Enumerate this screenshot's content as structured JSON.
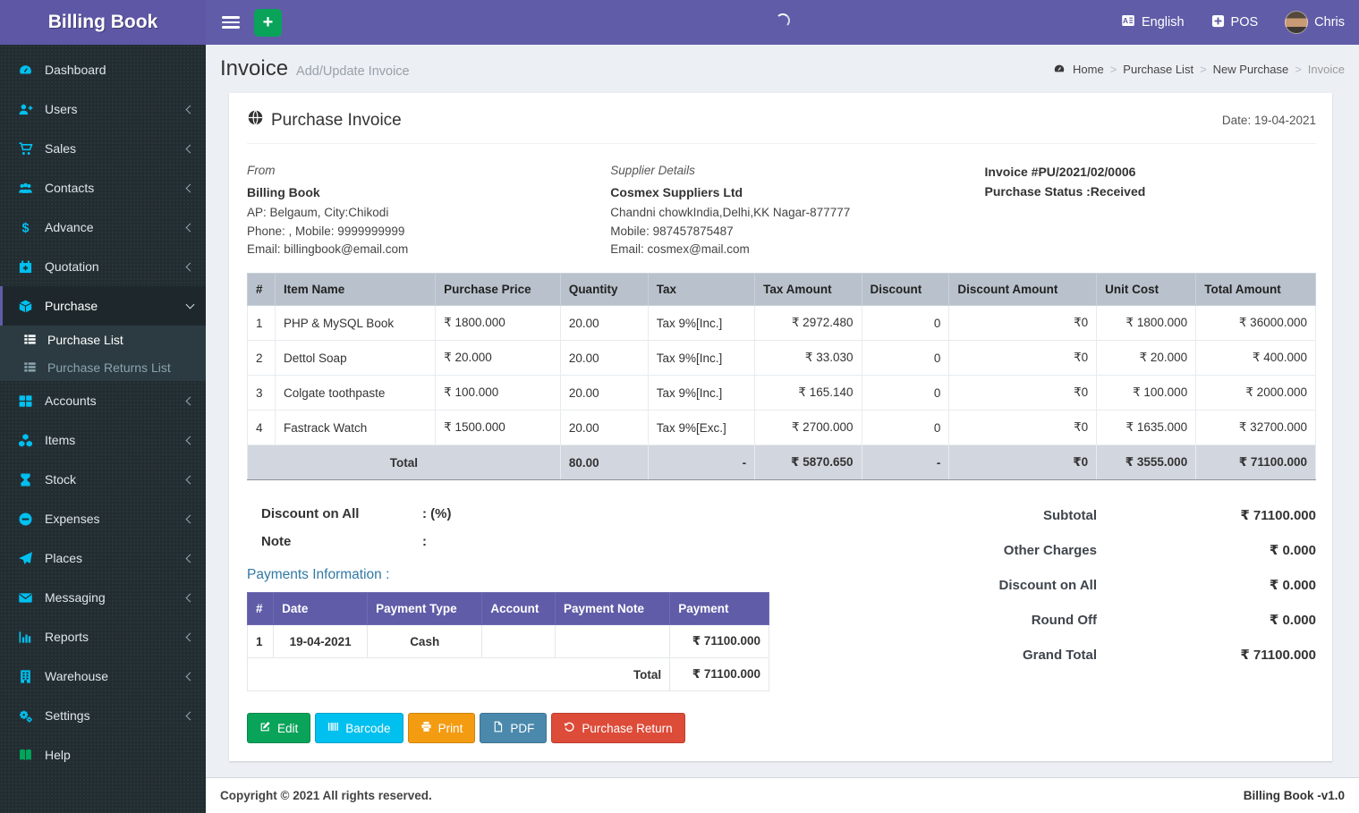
{
  "theme": {
    "topbar_purple": "#605ca8",
    "logo_purple": "#5d57a5",
    "sidebar_bg": "#222d32",
    "sidebar_icon_cyan": "#00c0ef",
    "content_bg": "#ecf0f5",
    "items_header_bg": "#b9c2cc",
    "total_row_bg": "#d2d6de",
    "payments_header_bg": "#605ca8",
    "btn_green": "#09a35a",
    "btn_cyan": "#00c0ef",
    "btn_orange": "#f39c12",
    "btn_blue": "#4a89ac",
    "btn_red": "#dd4b39"
  },
  "icons": {
    "menu-icon": "hamburger bars",
    "add-icon": "+",
    "language-icon": "translate page",
    "pos-icon": "plus-square",
    "home-icon": "gauge",
    "globe-icon": "globe",
    "chevron-left-icon": "‹",
    "chevron-down-icon": "⌄"
  },
  "topbar": {
    "brand": "Billing Book",
    "language": "English",
    "pos": "POS",
    "user": "Chris"
  },
  "sidebar": {
    "items": [
      {
        "label": "Dashboard",
        "icon": "dashboard-icon"
      },
      {
        "label": "Users",
        "icon": "user-plus-icon"
      },
      {
        "label": "Sales",
        "icon": "cart-icon"
      },
      {
        "label": "Contacts",
        "icon": "users-icon"
      },
      {
        "label": "Advance",
        "icon": "dollar-icon"
      },
      {
        "label": "Quotation",
        "icon": "calendar-plus-icon"
      },
      {
        "label": "Purchase",
        "icon": "cube-icon",
        "active": true,
        "expanded": true
      },
      {
        "label": "Accounts",
        "icon": "grid-icon"
      },
      {
        "label": "Items",
        "icon": "cubes-icon"
      },
      {
        "label": "Stock",
        "icon": "hourglass-icon"
      },
      {
        "label": "Expenses",
        "icon": "minus-circle-icon"
      },
      {
        "label": "Places",
        "icon": "paper-plane-icon"
      },
      {
        "label": "Messaging",
        "icon": "envelope-icon"
      },
      {
        "label": "Reports",
        "icon": "bar-chart-icon"
      },
      {
        "label": "Warehouse",
        "icon": "building-icon"
      },
      {
        "label": "Settings",
        "icon": "gears-icon"
      },
      {
        "label": "Help",
        "icon": "book-icon"
      }
    ],
    "submenu": [
      {
        "label": "Purchase List",
        "active": true
      },
      {
        "label": "Purchase Returns List",
        "active": false
      }
    ]
  },
  "page": {
    "title": "Invoice",
    "subtitle": "Add/Update Invoice",
    "breadcrumb": [
      "Home",
      "Purchase List",
      "New Purchase",
      "Invoice"
    ]
  },
  "invoice": {
    "card_title": "Purchase Invoice",
    "date": "Date: 19-04-2021",
    "from": {
      "heading": "From",
      "name": "Billing Book",
      "line1": "AP: Belgaum, City:Chikodi",
      "line2": "Phone: , Mobile: 9999999999",
      "line3": "Email: billingbook@email.com"
    },
    "supplier": {
      "heading": "Supplier Details",
      "name": "Cosmex Suppliers Ltd",
      "line1": "Chandni chowkIndia,Delhi,KK Nagar-877777",
      "line2": "Mobile: 987457875487",
      "line3": "Email: cosmex@mail.com"
    },
    "meta": {
      "invoice_no": "Invoice #PU/2021/02/0006",
      "status": "Purchase Status :Received"
    },
    "items_table": {
      "headers": [
        "#",
        "Item Name",
        "Purchase Price",
        "Quantity",
        "Tax",
        "Tax Amount",
        "Discount",
        "Discount Amount",
        "Unit Cost",
        "Total Amount"
      ],
      "rows": [
        [
          "1",
          "PHP & MySQL Book",
          "₹ 1800.000",
          "20.00",
          "Tax 9%[Inc.]",
          "₹ 2972.480",
          "0",
          "₹0",
          "₹ 1800.000",
          "₹ 36000.000"
        ],
        [
          "2",
          "Dettol Soap",
          "₹ 20.000",
          "20.00",
          "Tax 9%[Inc.]",
          "₹ 33.030",
          "0",
          "₹0",
          "₹ 20.000",
          "₹ 400.000"
        ],
        [
          "3",
          "Colgate toothpaste",
          "₹ 100.000",
          "20.00",
          "Tax 9%[Inc.]",
          "₹ 165.140",
          "0",
          "₹0",
          "₹ 100.000",
          "₹ 2000.000"
        ],
        [
          "4",
          "Fastrack Watch",
          "₹ 1500.000",
          "20.00",
          "Tax 9%[Exc.]",
          "₹ 2700.000",
          "0",
          "₹0",
          "₹ 1635.000",
          "₹ 32700.000"
        ]
      ],
      "total_row": [
        "Total",
        "80.00",
        "-",
        "₹ 5870.650",
        "-",
        "₹0",
        "₹ 3555.000",
        "₹ 71100.000"
      ]
    },
    "discount_on_all": {
      "label": "Discount on All",
      "value": ": (%)"
    },
    "note": {
      "label": "Note",
      "value": ":"
    },
    "payments": {
      "heading": "Payments Information :",
      "headers": [
        "#",
        "Date",
        "Payment Type",
        "Account",
        "Payment Note",
        "Payment"
      ],
      "rows": [
        [
          "1",
          "19-04-2021",
          "Cash",
          "",
          "",
          "₹ 71100.000"
        ]
      ],
      "total_label": "Total",
      "total_value": "₹ 71100.000"
    },
    "summary": [
      {
        "label": "Subtotal",
        "value": "₹ 71100.000"
      },
      {
        "label": "Other Charges",
        "value": "₹ 0.000"
      },
      {
        "label": "Discount on All",
        "value": "₹ 0.000"
      },
      {
        "label": "Round Off",
        "value": "₹ 0.000"
      },
      {
        "label": "Grand Total",
        "value": "₹ 71100.000"
      }
    ],
    "actions": [
      {
        "label": "Edit",
        "color": "#09a35a"
      },
      {
        "label": "Barcode",
        "color": "#00c0ef"
      },
      {
        "label": "Print",
        "color": "#f39c12"
      },
      {
        "label": "PDF",
        "color": "#4a89ac"
      },
      {
        "label": "Purchase Return",
        "color": "#dd4b39"
      }
    ]
  },
  "footer": {
    "left": "Copyright © 2021 All rights reserved.",
    "right": "Billing Book -v1.0"
  }
}
